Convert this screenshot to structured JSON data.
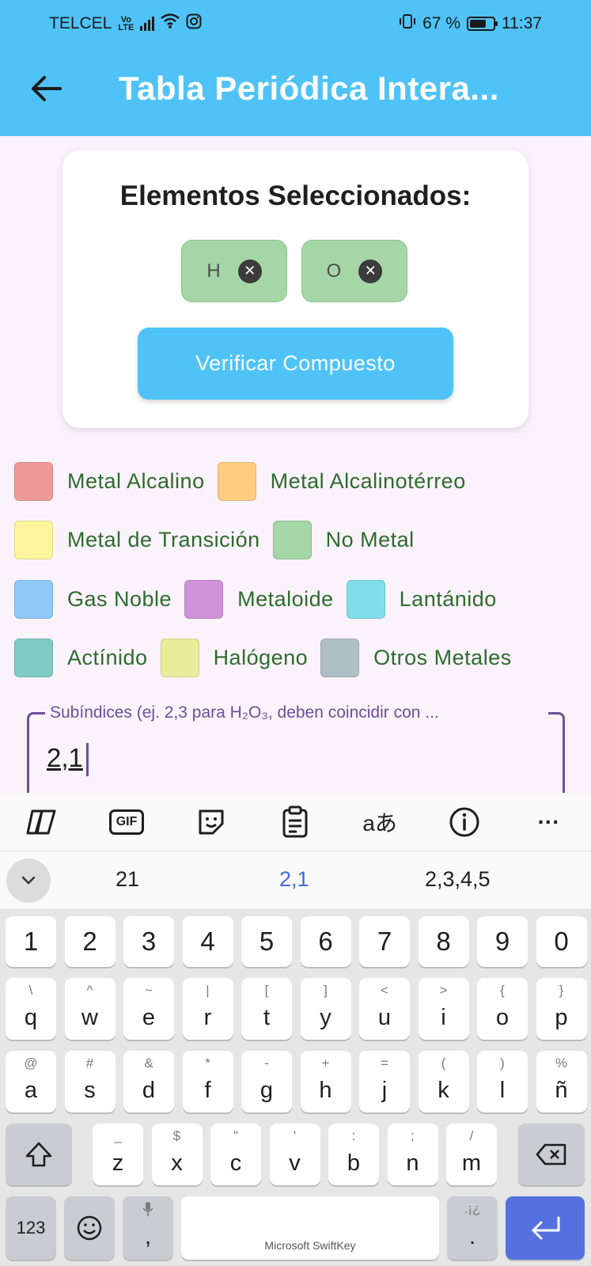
{
  "status_bar": {
    "carrier": "TELCEL",
    "volte_line1": "Vo",
    "volte_line2": "LTE",
    "battery": "67 %",
    "time": "11:37"
  },
  "app_bar": {
    "title": "Tabla Periódica Intera...",
    "back_icon": "arrow-left-icon"
  },
  "selection_card": {
    "title": "Elementos Seleccionados:",
    "chips": [
      {
        "symbol": "H"
      },
      {
        "symbol": "O"
      }
    ],
    "verify_button": "Verificar Compuesto"
  },
  "legend": [
    {
      "label": "Metal Alcalino",
      "color": "#ef9a9a"
    },
    {
      "label": "Metal Alcalinotérreo",
      "color": "#ffcc80"
    },
    {
      "label": "Metal de Transición",
      "color": "#fff59d"
    },
    {
      "label": "No Metal",
      "color": "#a5d6a7"
    },
    {
      "label": "Gas Noble",
      "color": "#90caf9"
    },
    {
      "label": "Metaloide",
      "color": "#ce93d8"
    },
    {
      "label": "Lantánido",
      "color": "#80deea"
    },
    {
      "label": "Actínido",
      "color": "#80cbc4"
    },
    {
      "label": "Halógeno",
      "color": "#e6ee9c"
    },
    {
      "label": "Otros Metales",
      "color": "#b0bec5"
    }
  ],
  "subscript_field": {
    "label": "Subíndices (ej. 2,3 para H₂O₃, deben coincidir con ...",
    "value": "2,1"
  },
  "keyboard": {
    "toolbar_icons": [
      "copilot-icon",
      "gif-icon",
      "sticker-icon",
      "clipboard-icon",
      "translate-icon",
      "info-icon",
      "more-icon"
    ],
    "gif_label": "GIF",
    "translate_label": "aあ",
    "more_label": "···",
    "suggestions": [
      "21",
      "2,1",
      "2,3,4,5"
    ],
    "row_numbers": [
      "1",
      "2",
      "3",
      "4",
      "5",
      "6",
      "7",
      "8",
      "9",
      "0"
    ],
    "row_q": [
      {
        "k": "q",
        "s": "\\"
      },
      {
        "k": "w",
        "s": "^"
      },
      {
        "k": "e",
        "s": "~"
      },
      {
        "k": "r",
        "s": "|"
      },
      {
        "k": "t",
        "s": "["
      },
      {
        "k": "y",
        "s": "]"
      },
      {
        "k": "u",
        "s": "<"
      },
      {
        "k": "i",
        "s": ">"
      },
      {
        "k": "o",
        "s": "{"
      },
      {
        "k": "p",
        "s": "}"
      }
    ],
    "row_a": [
      {
        "k": "a",
        "s": "@"
      },
      {
        "k": "s",
        "s": "#"
      },
      {
        "k": "d",
        "s": "&"
      },
      {
        "k": "f",
        "s": "*"
      },
      {
        "k": "g",
        "s": "-"
      },
      {
        "k": "h",
        "s": "+"
      },
      {
        "k": "j",
        "s": "="
      },
      {
        "k": "k",
        "s": "("
      },
      {
        "k": "l",
        "s": ")"
      },
      {
        "k": "ñ",
        "s": "%"
      }
    ],
    "row_z": [
      {
        "k": "z",
        "s": "_"
      },
      {
        "k": "x",
        "s": "$"
      },
      {
        "k": "c",
        "s": "\""
      },
      {
        "k": "v",
        "s": "'"
      },
      {
        "k": "b",
        "s": ":"
      },
      {
        "k": "n",
        "s": ";"
      },
      {
        "k": "m",
        "s": "/"
      }
    ],
    "key_123": "123",
    "key_comma": ",",
    "key_period": ".",
    "period_secondary": ".¡¿",
    "space_label": "Microsoft SwiftKey"
  }
}
